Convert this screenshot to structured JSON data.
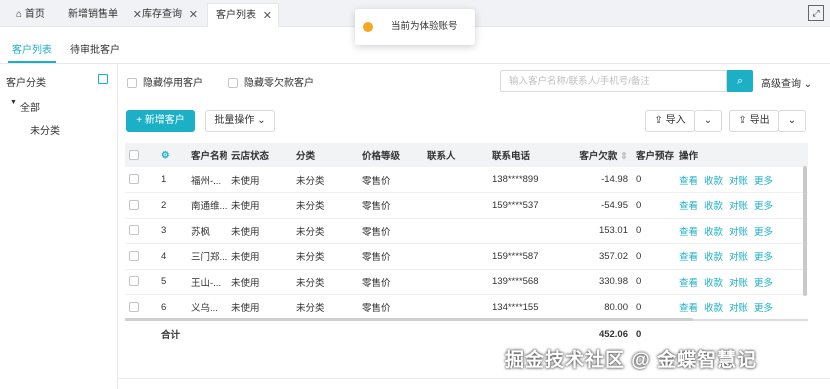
{
  "tabs": [
    {
      "label": "首页",
      "closable": false
    },
    {
      "label": "新增销售单",
      "closable": true
    },
    {
      "label": "库存查询",
      "closable": true
    },
    {
      "label": "客户列表",
      "closable": true,
      "active": true
    }
  ],
  "toast": {
    "text": "当前为体验账号"
  },
  "subtabs": [
    {
      "label": "客户列表",
      "active": true
    },
    {
      "label": "待审批客户",
      "active": false
    }
  ],
  "sidebar": {
    "title": "客户分类",
    "root": "全部",
    "child": "未分类"
  },
  "filters": {
    "hide_disabled": "隐藏停用客户",
    "hide_zero_debt": "隐藏零欠款客户"
  },
  "search": {
    "placeholder": "输入客户名称/联系人/手机号/备注",
    "advanced": "高级查询"
  },
  "toolbar": {
    "add": "+ 新增客户",
    "batch": "批量操作",
    "import": "导入",
    "export": "导出"
  },
  "table": {
    "headers": [
      "",
      "",
      "客户名称",
      "云店状态",
      "分类",
      "价格等级",
      "联系人",
      "联系电话",
      "客户欠款",
      "客户预存",
      "操作"
    ],
    "rows": [
      {
        "no": "1",
        "name": "福州-...",
        "status": "未使用",
        "category": "未分类",
        "price": "零售价",
        "contact": "",
        "phone": "138****899",
        "debt": "-14.98",
        "prepay": "0"
      },
      {
        "no": "2",
        "name": "南通维...",
        "status": "未使用",
        "category": "未分类",
        "price": "零售价",
        "contact": "",
        "phone": "159****537",
        "debt": "-54.95",
        "prepay": "0"
      },
      {
        "no": "3",
        "name": "苏枫",
        "status": "未使用",
        "category": "未分类",
        "price": "零售价",
        "contact": "",
        "phone": "",
        "debt": "153.01",
        "prepay": "0"
      },
      {
        "no": "4",
        "name": "三门郑...",
        "status": "未使用",
        "category": "未分类",
        "price": "零售价",
        "contact": "",
        "phone": "159****587",
        "debt": "357.02",
        "prepay": "0"
      },
      {
        "no": "5",
        "name": "王山-...",
        "status": "未使用",
        "category": "未分类",
        "price": "零售价",
        "contact": "",
        "phone": "139****568",
        "debt": "330.98",
        "prepay": "0"
      },
      {
        "no": "6",
        "name": "义乌...",
        "status": "未使用",
        "category": "未分类",
        "price": "零售价",
        "contact": "",
        "phone": "134****155",
        "debt": "80.00",
        "prepay": "0"
      }
    ],
    "ops": [
      "查看",
      "收款",
      "对账",
      "更多"
    ],
    "total": {
      "label": "合计",
      "debt": "452.06",
      "prepay": "0"
    }
  },
  "watermark": "掘金技术社区 @ 金蝶智慧记",
  "colors": {
    "accent": "#1cb0c7",
    "toast_dot": "#f5a623"
  }
}
